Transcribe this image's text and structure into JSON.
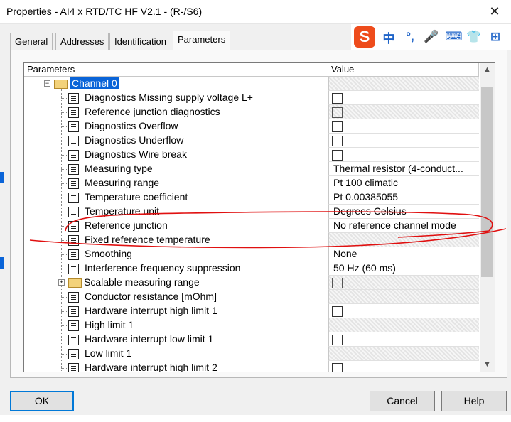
{
  "window": {
    "title": "Properties - AI4 x RTD/TC HF V2.1 - (R-/S6)",
    "close_glyph": "✕"
  },
  "tabs": [
    {
      "label": "General",
      "active": false
    },
    {
      "label": "Addresses",
      "active": false
    },
    {
      "label": "Identification",
      "active": false
    },
    {
      "label": "Parameters",
      "active": true
    }
  ],
  "ime_toolbar": {
    "logo": "S",
    "items": [
      "中",
      "°,",
      "🎤",
      "⌨",
      "👕",
      "⊞"
    ]
  },
  "table": {
    "headers": {
      "parameters": "Parameters",
      "value": "Value"
    },
    "rows": [
      {
        "label": "Channel 0",
        "type": "folder",
        "value_type": "hatched",
        "selected": true,
        "level": 1
      },
      {
        "label": "Diagnostics Missing supply voltage L+",
        "type": "param",
        "value_type": "checkbox",
        "level": 2
      },
      {
        "label": "Reference junction diagnostics",
        "type": "param",
        "value_type": "checkbox-disabled",
        "level": 2
      },
      {
        "label": "Diagnostics Overflow",
        "type": "param",
        "value_type": "checkbox",
        "level": 2
      },
      {
        "label": "Diagnostics Underflow",
        "type": "param",
        "value_type": "checkbox",
        "level": 2
      },
      {
        "label": "Diagnostics Wire break",
        "type": "param",
        "value_type": "checkbox",
        "level": 2
      },
      {
        "label": "Measuring type",
        "type": "param",
        "value_type": "text",
        "value": "Thermal resistor (4-conduct...",
        "level": 2
      },
      {
        "label": "Measuring range",
        "type": "param",
        "value_type": "text",
        "value": "Pt 100 climatic",
        "level": 2
      },
      {
        "label": "Temperature coefficient",
        "type": "param",
        "value_type": "text",
        "value": "Pt 0.00385055",
        "level": 2
      },
      {
        "label": "Temperature unit",
        "type": "param",
        "value_type": "text",
        "value": "Degrees Celsius",
        "level": 2
      },
      {
        "label": "Reference junction",
        "type": "param",
        "value_type": "text",
        "value": "No reference channel mode",
        "level": 2
      },
      {
        "label": "Fixed reference temperature",
        "type": "param",
        "value_type": "hatched",
        "level": 2
      },
      {
        "label": "Smoothing",
        "type": "param",
        "value_type": "text",
        "value": "None",
        "level": 2
      },
      {
        "label": "Interference frequency suppression",
        "type": "param",
        "value_type": "text",
        "value": "50 Hz (60 ms)",
        "level": 2
      },
      {
        "label": "Scalable measuring range",
        "type": "folder",
        "value_type": "checkbox-disabled",
        "level": 2
      },
      {
        "label": "Conductor resistance [mOhm]",
        "type": "param",
        "value_type": "hatched",
        "level": 2
      },
      {
        "label": "Hardware interrupt high limit 1",
        "type": "param",
        "value_type": "checkbox",
        "level": 2
      },
      {
        "label": "High limit 1",
        "type": "param",
        "value_type": "hatched",
        "level": 2
      },
      {
        "label": "Hardware interrupt low limit 1",
        "type": "param",
        "value_type": "checkbox",
        "level": 2
      },
      {
        "label": "Low limit 1",
        "type": "param",
        "value_type": "hatched",
        "level": 2
      },
      {
        "label": "Hardware interrupt high limit 2",
        "type": "param",
        "value_type": "checkbox",
        "level": 2
      }
    ]
  },
  "buttons": {
    "ok": "OK",
    "cancel": "Cancel",
    "help": "Help"
  },
  "colors": {
    "selection": "#0a64d8",
    "annotation": "#e01010"
  }
}
